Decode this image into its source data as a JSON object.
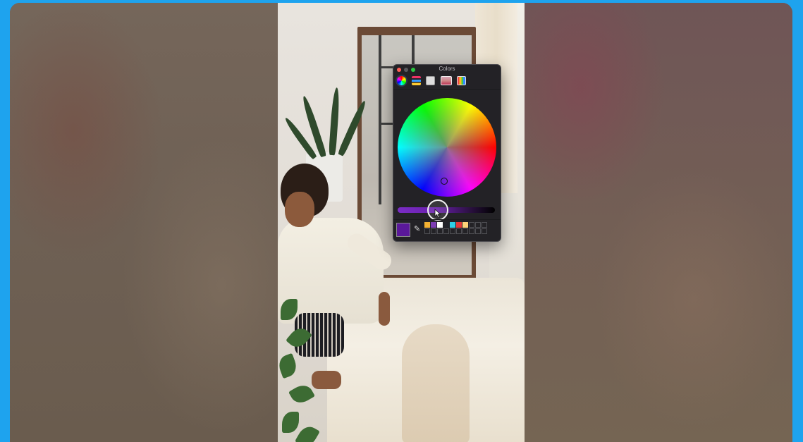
{
  "colors_panel": {
    "title": "Colors",
    "toolbar": [
      {
        "name": "color-wheel-tab-icon"
      },
      {
        "name": "color-sliders-tab-icon"
      },
      {
        "name": "color-palettes-tab-icon"
      },
      {
        "name": "image-palettes-tab-icon"
      },
      {
        "name": "pencils-tab-icon"
      }
    ],
    "selected_color": "#5a189a",
    "wheel_cursor_icon": "crosshair-icon",
    "eyedropper_icon": "eyedropper-icon",
    "swatches_row1": [
      "#f5b233",
      "#7d3cb4",
      "#ffffff",
      "#23232a",
      "#2ed0e6",
      "#e33a3a",
      "#ffd479",
      "",
      "",
      ""
    ],
    "swatches_row2": [
      "",
      "",
      "",
      "",
      "",
      "",
      "",
      "",
      "",
      ""
    ]
  },
  "colors": {
    "desktop_background": "#1ea3ee",
    "panel_background": "#232226"
  }
}
